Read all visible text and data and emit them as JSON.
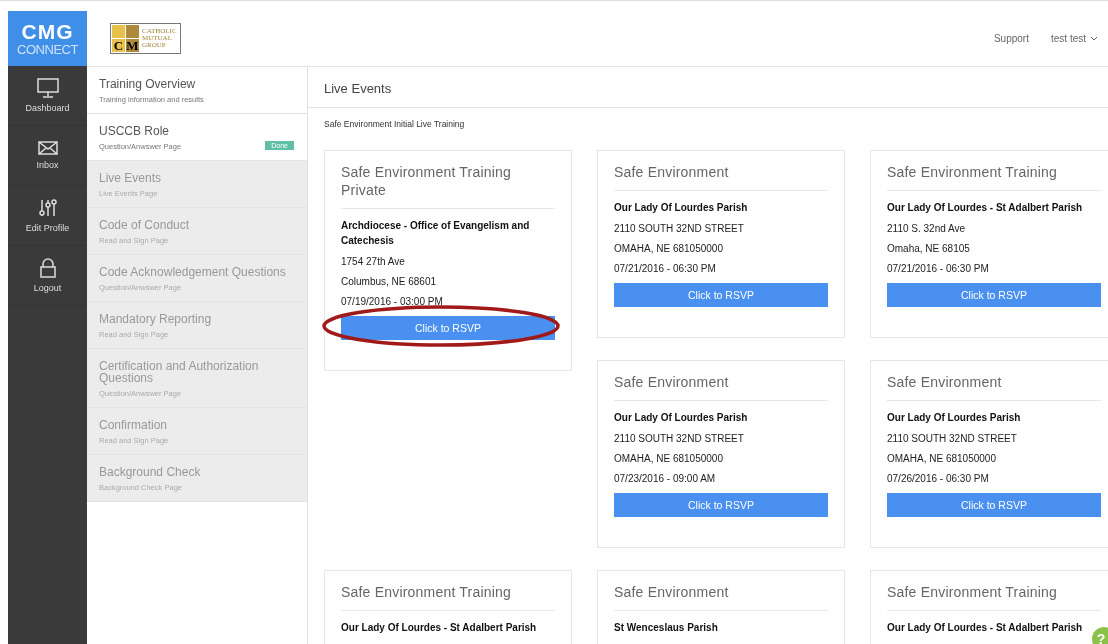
{
  "brand": {
    "title": "CMG",
    "subtitle": "CONNECT"
  },
  "org_logo": {
    "letters": [
      "C",
      "M"
    ],
    "lines": [
      "CATHOLIC",
      "MUTUAL",
      "GROUP"
    ]
  },
  "header": {
    "links": [
      "Support"
    ],
    "user": "test test"
  },
  "nav": [
    {
      "label": "Dashboard",
      "kind": "monitor"
    },
    {
      "label": "Inbox",
      "kind": "mail"
    },
    {
      "label": "Edit Profile",
      "kind": "sliders"
    },
    {
      "label": "Logout",
      "kind": "lock"
    }
  ],
  "steps": [
    {
      "title": "Training Overview",
      "subtitle": "Training information and results",
      "available": true
    },
    {
      "title": "USCCB Role",
      "subtitle": "Question/Anwswer Page",
      "available": true,
      "badge": "Done"
    },
    {
      "title": "Live Events",
      "subtitle": "Live Events Page",
      "available": false
    },
    {
      "title": "Code of Conduct",
      "subtitle": "Read and Sign Page",
      "available": false
    },
    {
      "title": "Code Acknowledgement Questions",
      "subtitle": "Question/Anwswer Page",
      "available": false
    },
    {
      "title": "Mandatory Reporting",
      "subtitle": "Read and Sign Page",
      "available": false
    },
    {
      "title": "Certification and Authorization Questions",
      "subtitle": "Question/Anwswer Page",
      "available": false
    },
    {
      "title": "Confirmation",
      "subtitle": "Read and Sign Page",
      "available": false
    },
    {
      "title": "Background Check",
      "subtitle": "Background Check Page",
      "available": false
    }
  ],
  "main": {
    "title": "Live Events",
    "subtitle": "Safe Environment Initial Live Training"
  },
  "events": [
    {
      "title": "Safe Environment Training Private",
      "org": "Archdiocese - Office of Evangelism and Catechesis",
      "lines": [
        "1754 27th Ave",
        "Columbus, NE 68601",
        "07/19/2016 - 03:00 PM"
      ],
      "button": "Click to RSVP",
      "highlighted": true
    },
    {
      "title": "Safe Environment",
      "org": "Our Lady Of Lourdes Parish",
      "lines": [
        "2110 SOUTH 32ND STREET",
        "OMAHA, NE 681050000",
        "07/21/2016 - 06:30 PM"
      ],
      "button": "Click to RSVP",
      "highlighted": false
    },
    {
      "title": "Safe Environment Training",
      "org": "Our Lady Of Lourdes - St Adalbert Parish",
      "lines": [
        "2110 S. 32nd Ave",
        "Omaha, NE 68105",
        "07/21/2016 - 06:30 PM"
      ],
      "button": "Click to RSVP",
      "highlighted": false
    },
    {
      "title": "Safe Environment",
      "org": "Our Lady Of Lourdes Parish",
      "lines": [
        "2110 SOUTH 32ND STREET",
        "OMAHA, NE 681050000",
        "07/23/2016 - 09:00 AM"
      ],
      "button": "Click to RSVP",
      "highlighted": false
    },
    {
      "title": "Safe Environment",
      "org": "Our Lady Of Lourdes Parish",
      "lines": [
        "2110 SOUTH 32ND STREET",
        "OMAHA, NE 681050000",
        "07/26/2016 - 06:30 PM"
      ],
      "button": "Click to RSVP",
      "highlighted": false
    },
    {
      "title": "Safe Environment Training",
      "org": "Our Lady Of Lourdes - St Adalbert Parish",
      "highlighted": false
    },
    {
      "title": "Safe Environment",
      "org": "St Wenceslaus Parish",
      "highlighted": false
    },
    {
      "title": "Safe Environment Training",
      "org": "Our Lady Of Lourdes - St Adalbert Parish",
      "highlighted": false
    }
  ],
  "help": {
    "label": "?"
  }
}
